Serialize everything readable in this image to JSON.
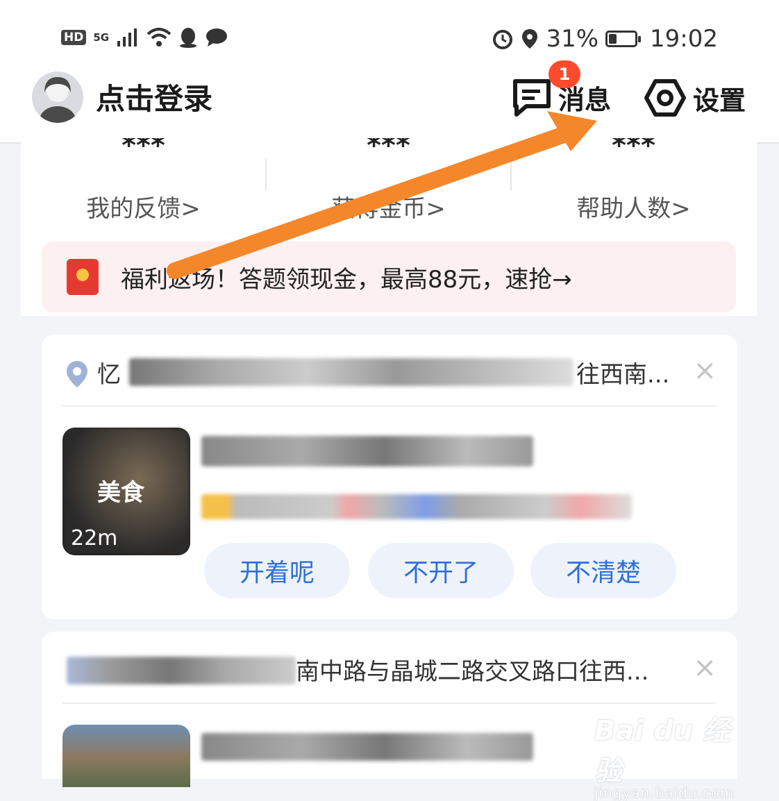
{
  "status_bar": {
    "hd": "HD",
    "network": "5G",
    "battery_percent": "31%",
    "battery_level": 0.31,
    "time": "19:02"
  },
  "header": {
    "login_label": "点击登录",
    "messages_label": "消息",
    "messages_badge": "1",
    "settings_label": "设置"
  },
  "stats": [
    {
      "value": "***",
      "label": "我的反馈>"
    },
    {
      "value": "***",
      "label": "获得金币>"
    },
    {
      "value": "***",
      "label": "帮助人数>"
    }
  ],
  "promo": {
    "text": "福利返场！答题领现金，最高88元，速抢→"
  },
  "poi_cards": [
    {
      "title_prefix": "忆",
      "title_suffix": "往西南...",
      "thumb_tag": "美食",
      "distance": "22m",
      "options": [
        "开着呢",
        "不开了",
        "不清楚"
      ]
    },
    {
      "title_suffix": "南中路与晶城二路交叉路口往西...",
      "close": "×"
    }
  ],
  "close_symbol": "×",
  "annotation": {
    "color": "#f4872a"
  },
  "watermark": {
    "logo": "Bai du 经验",
    "url": "jingyan.baidu.com"
  }
}
